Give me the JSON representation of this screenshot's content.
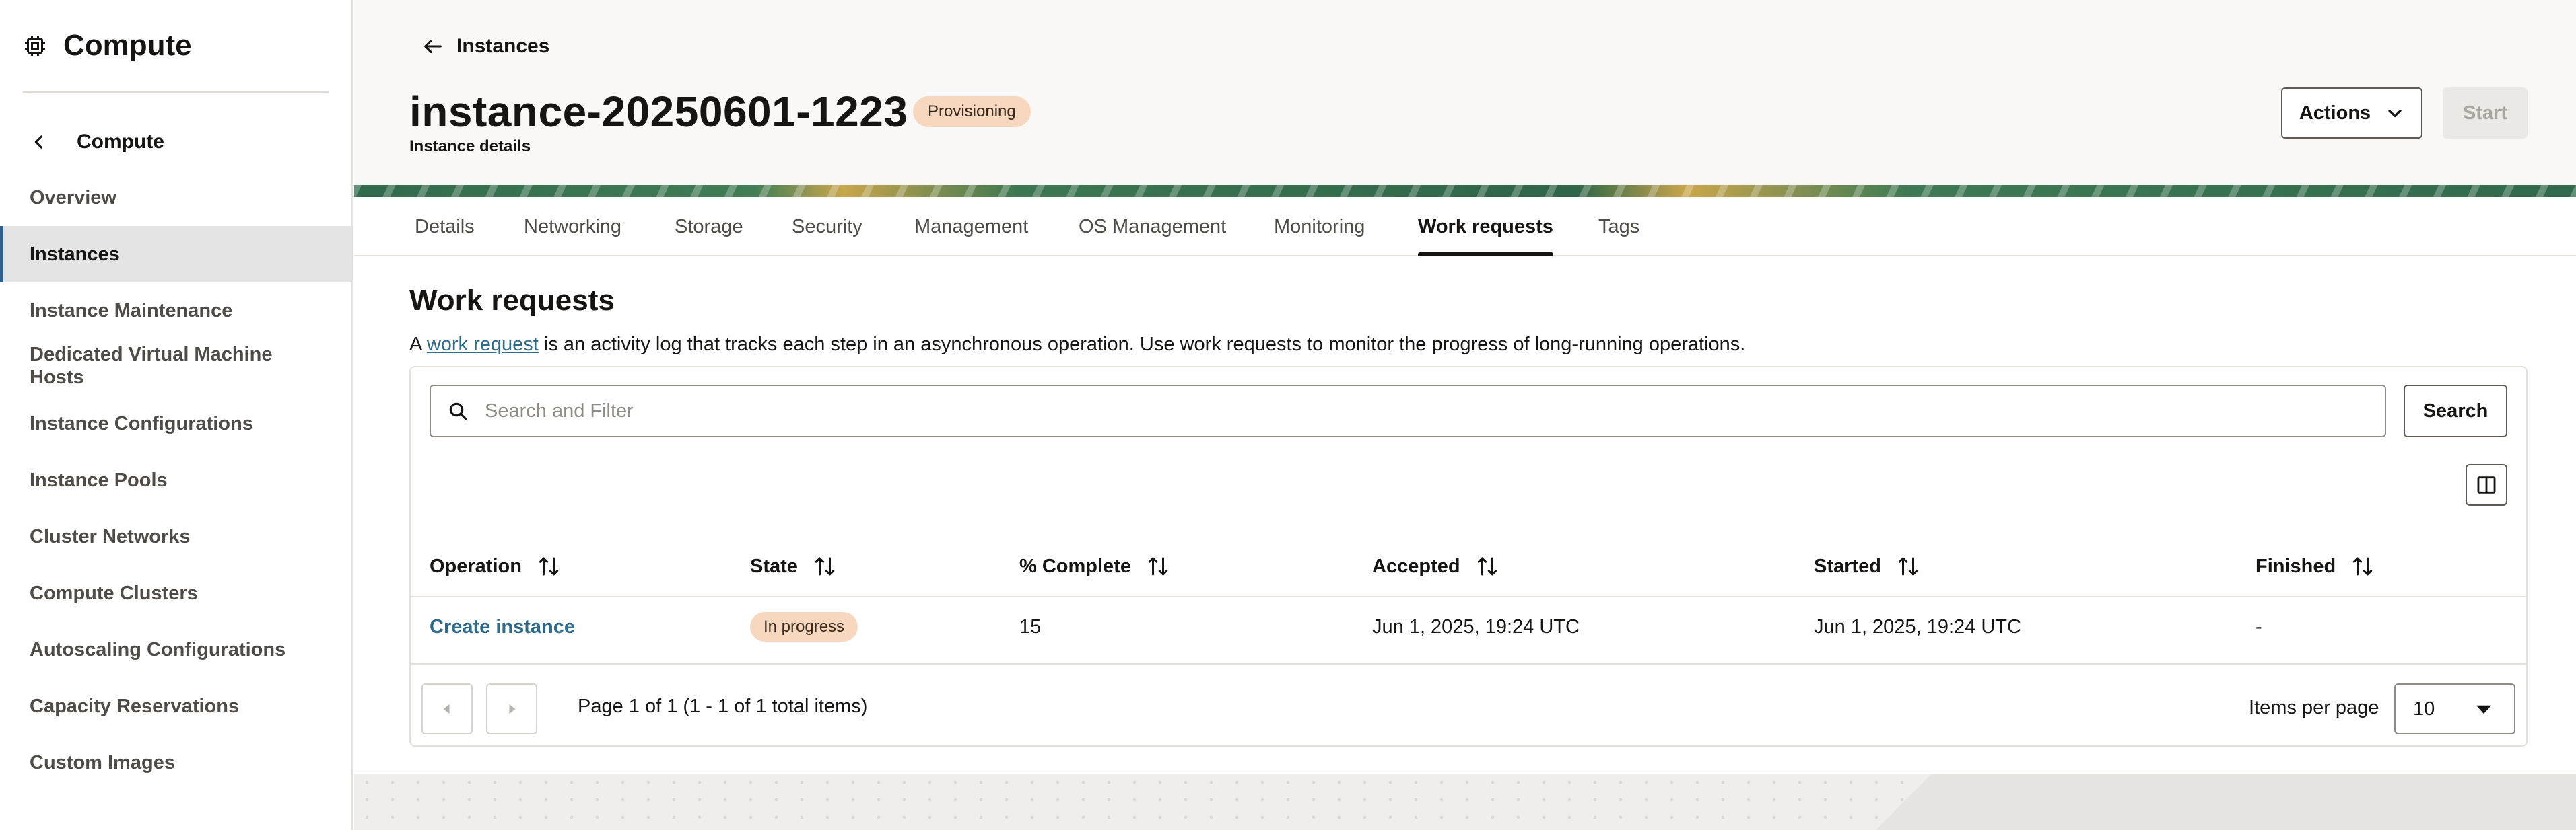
{
  "sidebar": {
    "title": "Compute",
    "back_label": "Compute",
    "items": [
      {
        "label": "Overview",
        "active": false
      },
      {
        "label": "Instances",
        "active": true
      },
      {
        "label": "Instance Maintenance",
        "active": false
      },
      {
        "label": "Dedicated Virtual Machine Hosts",
        "active": false
      },
      {
        "label": "Instance Configurations",
        "active": false
      },
      {
        "label": "Instance Pools",
        "active": false
      },
      {
        "label": "Cluster Networks",
        "active": false
      },
      {
        "label": "Compute Clusters",
        "active": false
      },
      {
        "label": "Autoscaling Configurations",
        "active": false
      },
      {
        "label": "Capacity Reservations",
        "active": false
      },
      {
        "label": "Custom Images",
        "active": false
      }
    ]
  },
  "header": {
    "back_label": "Instances",
    "instance_name": "instance-20250601-1223",
    "status_badge": "Provisioning",
    "subtitle": "Instance details",
    "actions_label": "Actions",
    "start_label": "Start"
  },
  "tabs": [
    {
      "label": "Details",
      "active": false
    },
    {
      "label": "Networking",
      "active": false
    },
    {
      "label": "Storage",
      "active": false
    },
    {
      "label": "Security",
      "active": false
    },
    {
      "label": "Management",
      "active": false
    },
    {
      "label": "OS Management",
      "active": false
    },
    {
      "label": "Monitoring",
      "active": false
    },
    {
      "label": "Work requests",
      "active": true
    },
    {
      "label": "Tags",
      "active": false
    }
  ],
  "work_requests": {
    "title": "Work requests",
    "desc_prefix": "A ",
    "desc_link": "work request",
    "desc_suffix": " is an activity log that tracks each step in an asynchronous operation. Use work requests to monitor the progress of long-running operations.",
    "search_placeholder": "Search and Filter",
    "search_label": "Search",
    "columns": [
      "Operation",
      "State",
      "% Complete",
      "Accepted",
      "Started",
      "Finished"
    ],
    "rows": [
      {
        "operation": "Create instance",
        "state": "In progress",
        "percent_complete": "15",
        "accepted": "Jun 1, 2025, 19:24 UTC",
        "started": "Jun 1, 2025, 19:24 UTC",
        "finished": "-"
      }
    ],
    "pagination_text": "Page 1 of 1 (1 - 1 of 1 total items)",
    "items_per_page_label": "Items per page",
    "items_per_page": "10"
  },
  "colors": {
    "badge_bg": "#f7d8bf",
    "link": "#2e6a8c",
    "active_nav_border": "#2f5e8e"
  },
  "icons": [
    "chip-icon",
    "chevron-left-icon",
    "arrow-left-icon",
    "chevron-down-icon",
    "search-icon",
    "columns-icon",
    "sort-icon",
    "caret-left-icon",
    "caret-right-icon",
    "caret-down-icon"
  ]
}
